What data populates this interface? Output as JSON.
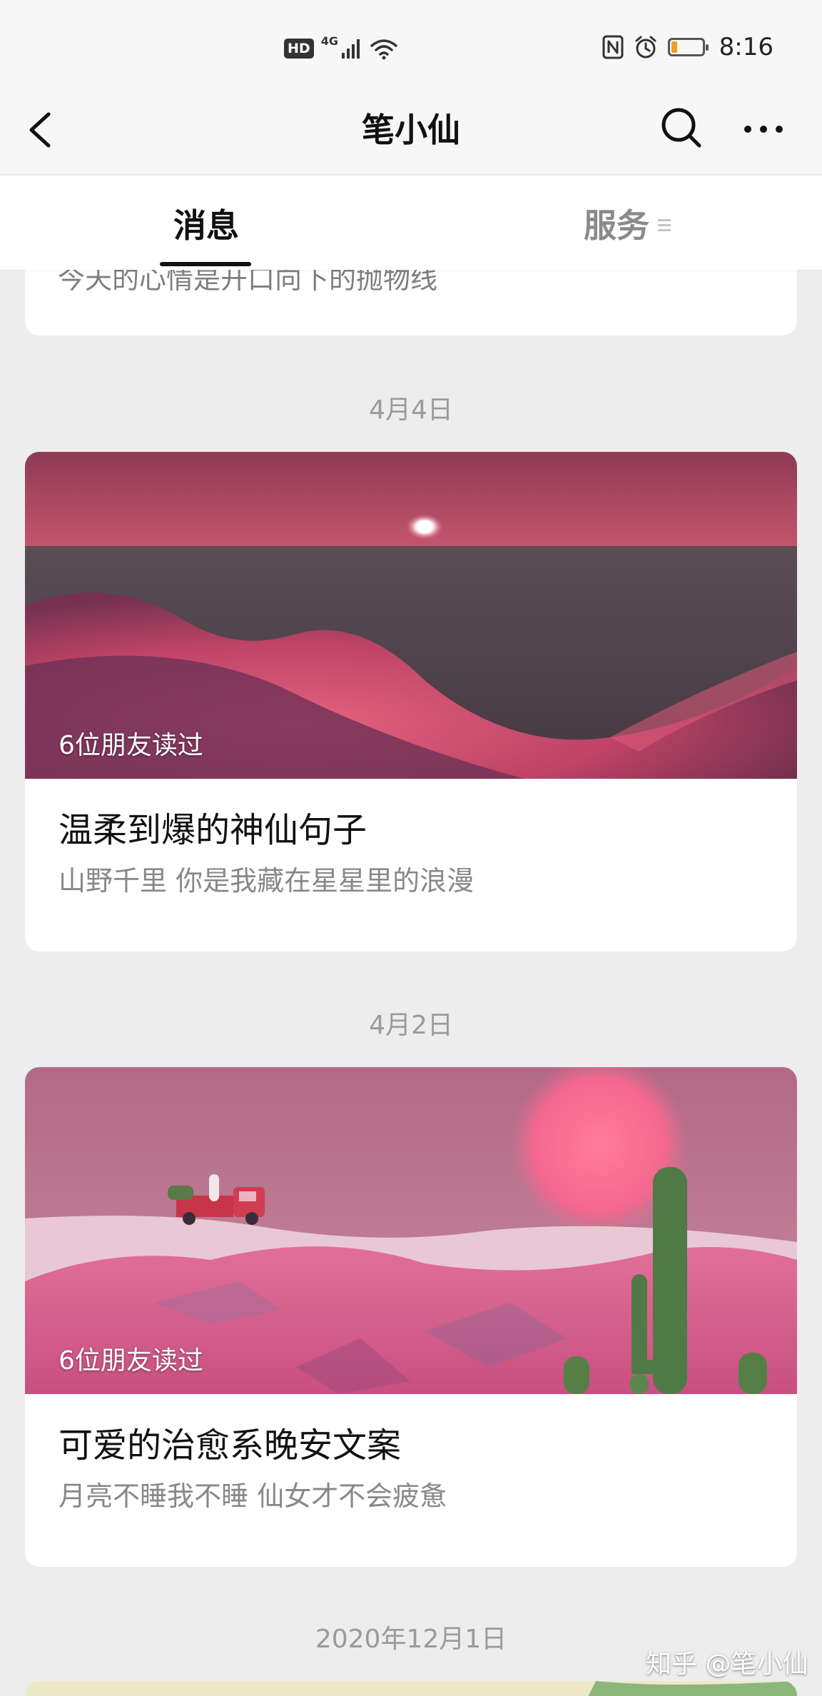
{
  "status_bar": {
    "hd_badge": "HD",
    "network": "4G",
    "time": "8:16",
    "battery_level_fraction": 0.18,
    "battery_color": "#f0a020"
  },
  "nav": {
    "title": "笔小仙",
    "back_icon": "chevron-left-icon",
    "search_icon": "search-icon",
    "more_icon": "more-horizontal-icon"
  },
  "tabs": {
    "messages": "消息",
    "services": "服务",
    "active": "消息"
  },
  "feed": {
    "partial_card_text": "今天的心情是开口向下的抛物线",
    "groups": [
      {
        "date": "4月4日",
        "article": {
          "readers": "6位朋友读过",
          "title": "温柔到爆的神仙句子",
          "summary": "山野千里 你是我藏在星星里的浪漫"
        }
      },
      {
        "date": "4月2日",
        "article": {
          "readers": "6位朋友读过",
          "title": "可爱的治愈系晚安文案",
          "summary": "月亮不睡我不睡 仙女才不会疲惫"
        }
      },
      {
        "date": "2020年12月1日"
      }
    ]
  },
  "watermark": "知乎 @笔小仙"
}
